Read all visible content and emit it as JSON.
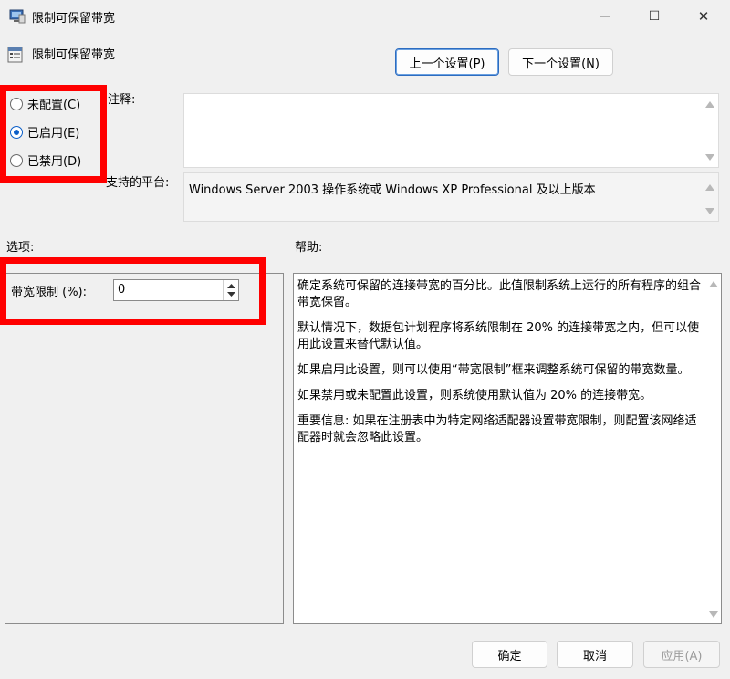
{
  "window": {
    "title": "限制可保留带宽",
    "controls": {
      "minimize": "—",
      "maximize": "☐",
      "close": "✕"
    }
  },
  "policy": {
    "name": "限制可保留带宽",
    "icon": "policy-icon"
  },
  "nav": {
    "prev_label": "上一个设置(P)",
    "next_label": "下一个设置(N)"
  },
  "state": {
    "options": [
      {
        "label": "未配置(C)",
        "checked": false
      },
      {
        "label": "已启用(E)",
        "checked": true
      },
      {
        "label": "已禁用(D)",
        "checked": false
      }
    ]
  },
  "comment": {
    "label": "注释:",
    "value": ""
  },
  "platform": {
    "label": "支持的平台:",
    "value": "Windows Server 2003 操作系统或 Windows XP Professional 及以上版本"
  },
  "options_section": {
    "label": "选项:",
    "bandwidth_label": "带宽限制 (%):",
    "bandwidth_value": "0"
  },
  "help": {
    "label": "帮助:",
    "paragraphs": [
      "确定系统可保留的连接带宽的百分比。此值限制系统上运行的所有程序的组合带宽保留。",
      "默认情况下，数据包计划程序将系统限制在 20% 的连接带宽之内，但可以使用此设置来替代默认值。",
      "如果启用此设置，则可以使用“带宽限制”框来调整系统可保留的带宽数量。",
      "如果禁用或未配置此设置，则系统使用默认值为 20% 的连接带宽。",
      "重要信息: 如果在注册表中为特定网络适配器设置带宽限制，则配置该网络适配器时就会忽略此设置。"
    ]
  },
  "footer": {
    "ok_label": "确定",
    "cancel_label": "取消",
    "apply_label": "应用(A)"
  },
  "colors": {
    "highlight": "#ff0000",
    "accent": "#0a5ec8"
  }
}
